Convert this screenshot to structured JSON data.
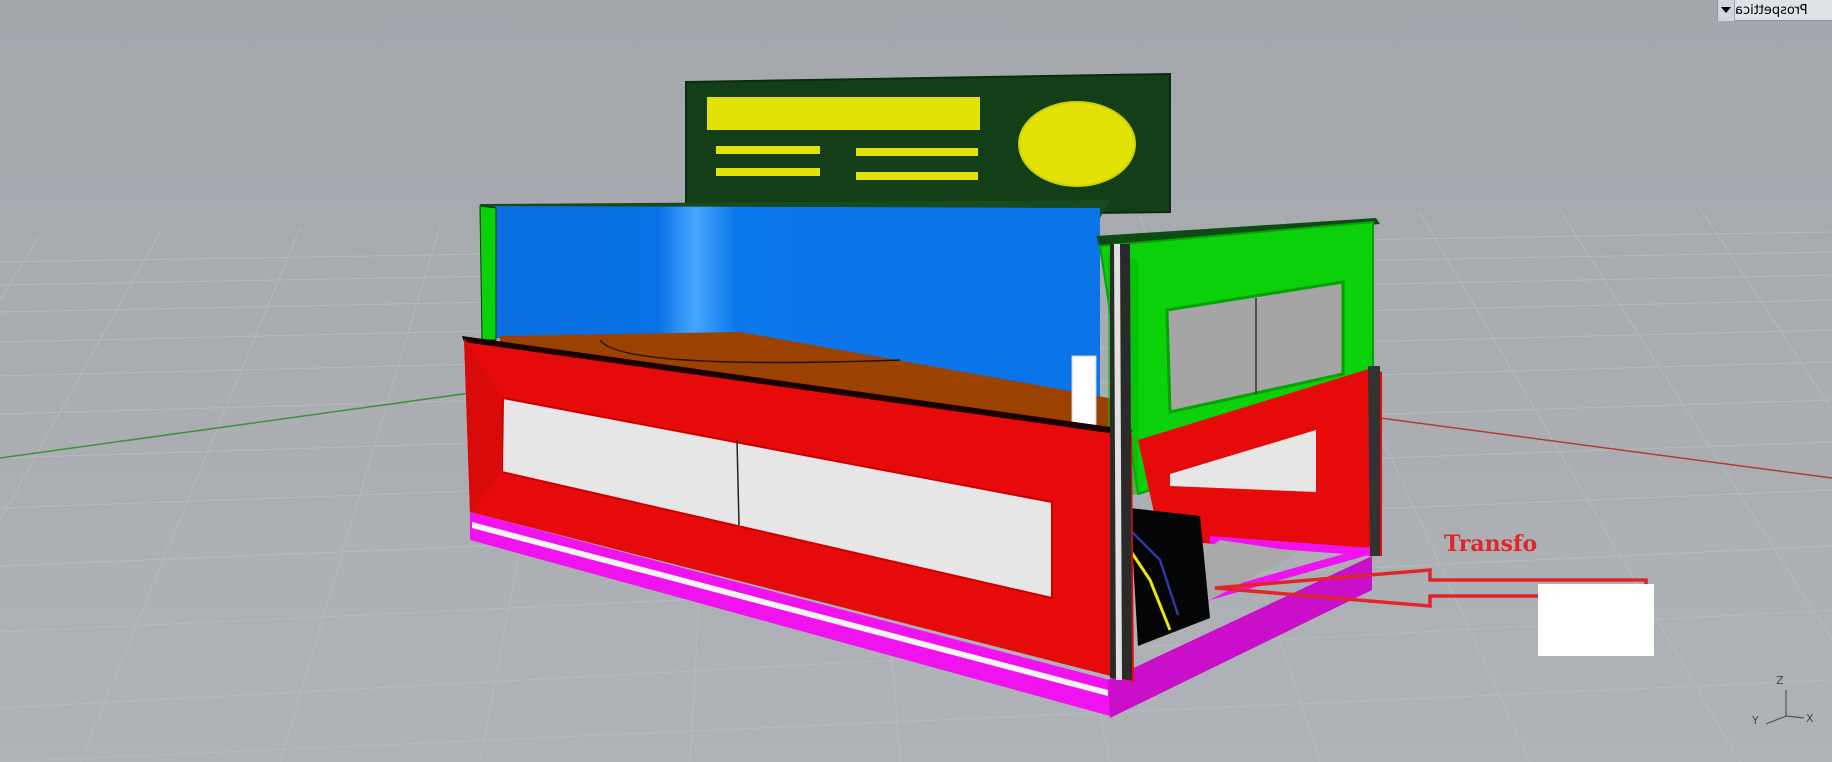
{
  "viewport": {
    "label": "Prospettica",
    "menu_icon": "triangle-down-icon"
  },
  "scene": {
    "annotation": "Transfo",
    "axis": {
      "z": "Z",
      "y": "Y",
      "x": "X"
    }
  },
  "colors": {
    "background": "#a7abb0",
    "grid_line": "#b6babe",
    "axis_x": "#b33a3a",
    "axis_y": "#3f8f3f",
    "red_panel": "#e60a0a",
    "blue_wall": "#0873e6",
    "green_panel": "#0ad10a",
    "dark_green_sign": "#123f18",
    "yellow_sign": "#e2e207",
    "magenta_base": "#f013f0",
    "brown_floor": "#9b4200",
    "annotation_red": "#e0262a"
  }
}
